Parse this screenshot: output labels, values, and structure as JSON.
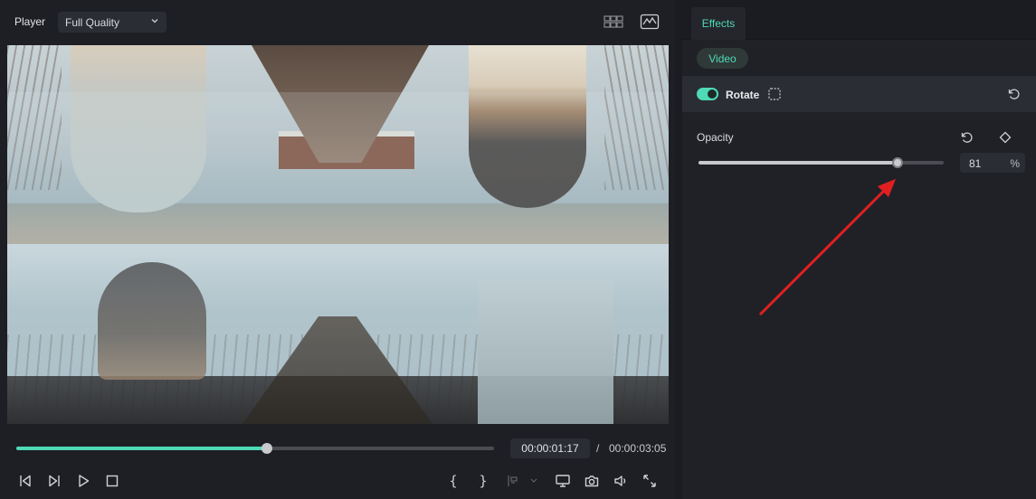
{
  "player": {
    "title": "Player",
    "quality": "Full Quality",
    "progress": 0.524,
    "current_time": "00:00:01:17",
    "separator": "/",
    "total_time": "00:00:03:05",
    "brace_open": "{",
    "brace_close": "}"
  },
  "effects": {
    "tab": "Effects",
    "pill": "Video",
    "rotate_label": "Rotate",
    "rotate_enabled": true,
    "opacity_label": "Opacity",
    "opacity_value": "81",
    "opacity_unit": "%",
    "accent": "#4fd9b6",
    "annotation_color": "#e02020"
  }
}
